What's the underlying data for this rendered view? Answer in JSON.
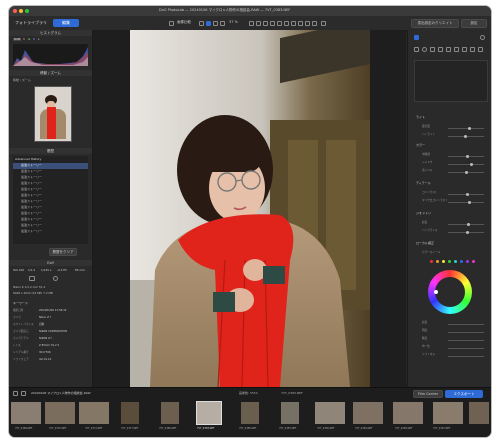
{
  "window": {
    "title": "DxO PhotoLab — 20240106 マイクロ×人物作の相談会-RAW — 7VT_0383.NEF",
    "traffic_lights": [
      "#ff5f57",
      "#febc2e",
      "#28c840"
    ]
  },
  "toolbar": {
    "tab_library": "フォトライブラリ",
    "tab_edit": "編集",
    "compare_label": "画像比較",
    "zoom_label": "37 %",
    "export_button": "書出設定のクリエイト",
    "settings_button": "設定"
  },
  "left_panel": {
    "histogram_title": "ヒストグラム",
    "histogram_buttons": [
      "RGB",
      "R",
      "G",
      "B",
      "L"
    ],
    "nav_title": "移動 / ズーム",
    "nav_label": "移動 / ズーム",
    "history_title": "履歴",
    "history_items": [
      "Advanced History",
      "最適ストーリー",
      "最適ストーリー",
      "最適ストーリー",
      "最適ストーリー",
      "最適ストーリー",
      "最適ストーリー",
      "最適ストーリー",
      "最適ストーリー",
      "最適ストーリー",
      "最適ストーリー",
      "最適ストーリー",
      "最適ストーリー"
    ],
    "clear_history": "履歴をクリア",
    "exif_title": "Exif",
    "exif_values": [
      "ISO 100",
      "1/1.2",
      "1/125 s",
      "-0.3 EV",
      "85 mm"
    ],
    "exif_lens": "Nikon Z 1/1.2 mm f/1.2",
    "exif_dims": "6048 x 4024 (24 MP) 7.2 MB",
    "keywords_title": "キーワード",
    "meta_rows": [
      {
        "label": "撮影日時",
        "value": "2024/01/06 13:56:32"
      },
      {
        "label": "カメラ",
        "value": "Nikon Z f"
      },
      {
        "label": "ホワイトバランス",
        "value": "自動"
      },
      {
        "label": "カメラ製造元",
        "value": "NIKON CORPORATION"
      },
      {
        "label": "カメラモデル",
        "value": "NIKON Z f"
      },
      {
        "label": "レンズ",
        "value": "Z 85mm f/1.2 S"
      },
      {
        "label": "シリアル番号",
        "value": "3017706"
      },
      {
        "label": "ソフトウェア",
        "value": "Ver.01.10"
      }
    ]
  },
  "right_panel": {
    "section_titles": [
      "ライト",
      "カラー",
      "ディテール",
      "ジオメトリ",
      "ローカル補正"
    ],
    "slider_labels": [
      "露光量",
      "ハイライト",
      "中間調",
      "シャドウ",
      "黒レベル",
      "コントラスト",
      "マイクロコントラスト",
      "彩度",
      "バイブランス",
      "色相",
      "ホワイトバランス",
      "色温度",
      "色かぶり"
    ],
    "color_wheel_title": "カラーホイール",
    "bottom_sliders": [
      "彩度",
      "明度",
      "輝度",
      "均一性",
      "ソフトネス"
    ]
  },
  "filmstrip": {
    "folder_path": "20240106 マイクロ×人物作の相談会-RAW",
    "count_label": "画像数: 5554",
    "file_label": "7VT_0383.NEF",
    "right_button": "Film Carrier",
    "export_button": "エクスポート",
    "thumbnails": [
      "7VT_0368.NEF",
      "7VT_0370.NEF",
      "7VT_0372.NEF",
      "7VT_0377.NEF",
      "7VT_0380.NEF",
      "7VT_0383.NEF",
      "7VT_0385.NEF",
      "7VT_0387.NEF",
      "7VT_0390.NEF",
      "7VT_0392.NEF",
      "7VT_0395.NEF",
      "7VT_0397.NEF"
    ]
  }
}
